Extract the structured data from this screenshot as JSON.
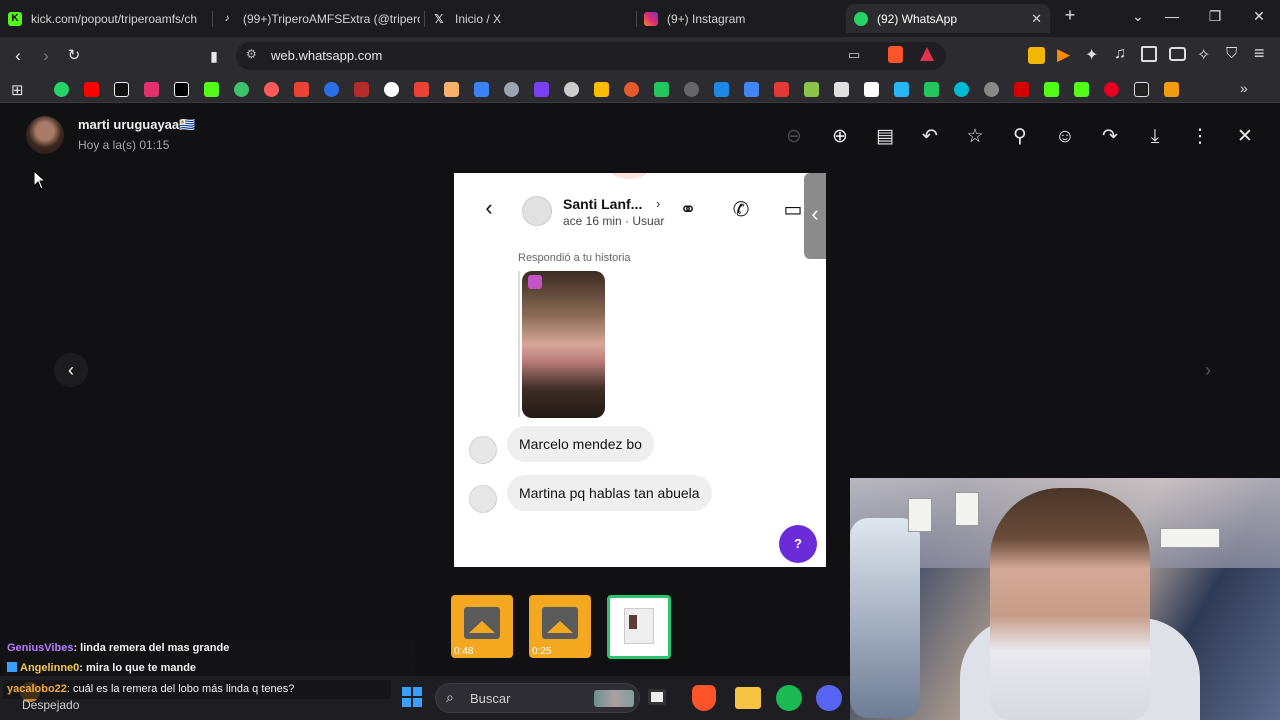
{
  "tabs": [
    {
      "title": "kick.com/popout/triperoamfs/ch",
      "icon": "kick-icon",
      "color": "#53fc18",
      "active": false
    },
    {
      "title": "(99+)TriperoAMFSExtra (@triperc",
      "icon": "tiktok-icon",
      "color": "#ffffff",
      "active": false
    },
    {
      "title": "Inicio / X",
      "icon": "x-icon",
      "color": "#ffffff",
      "active": false
    },
    {
      "title": "(9+) Instagram",
      "icon": "instagram-icon",
      "color": "#e1306c",
      "active": false
    },
    {
      "title": "(92) WhatsApp",
      "icon": "whatsapp-icon",
      "color": "#25d366",
      "active": true
    }
  ],
  "new_tab_glyph": "+",
  "window_controls": {
    "list": "⌄",
    "minimize": "—",
    "restore": "❐",
    "close": "✕"
  },
  "address": {
    "url": "web.whatsapp.com"
  },
  "viewer": {
    "sender_name": "marti uruguayaa🇺🇾",
    "timestamp": "Hoy a la(s) 01:15",
    "tools": [
      "zoom-out-icon",
      "zoom-in-icon",
      "caption-icon",
      "reply-icon",
      "star-icon",
      "pin-icon",
      "emoji-icon",
      "forward-icon",
      "download-icon",
      "more-icon",
      "close-icon"
    ]
  },
  "screenshot": {
    "contact_name": "Santi Lanf...",
    "contact_sub": "ace 16 min · Usuar",
    "replied_label": "Respondió a tu historia",
    "messages": [
      "Marcelo mendez bo",
      "Martina pq hablas tan abuela"
    ],
    "help_label": "?"
  },
  "thumbnails": [
    {
      "type": "media",
      "duration": "0:48"
    },
    {
      "type": "media",
      "duration": "0:25"
    },
    {
      "type": "image",
      "duration": ""
    }
  ],
  "chat": [
    {
      "user": "GeniusVibes",
      "text": ": linda remera del mas grande",
      "user_color": "#b57bff"
    },
    {
      "user": "Angelinne0",
      "text": ": mira lo que te mande",
      "user_color": "#f2c94c"
    },
    {
      "user": "yacalobo22",
      "text": ": cuál es la remera del lobo más linda q tenes?",
      "user_color": "#f2a93b"
    }
  ],
  "taskbar": {
    "weather": "Despejado",
    "search_placeholder": "Buscar"
  }
}
